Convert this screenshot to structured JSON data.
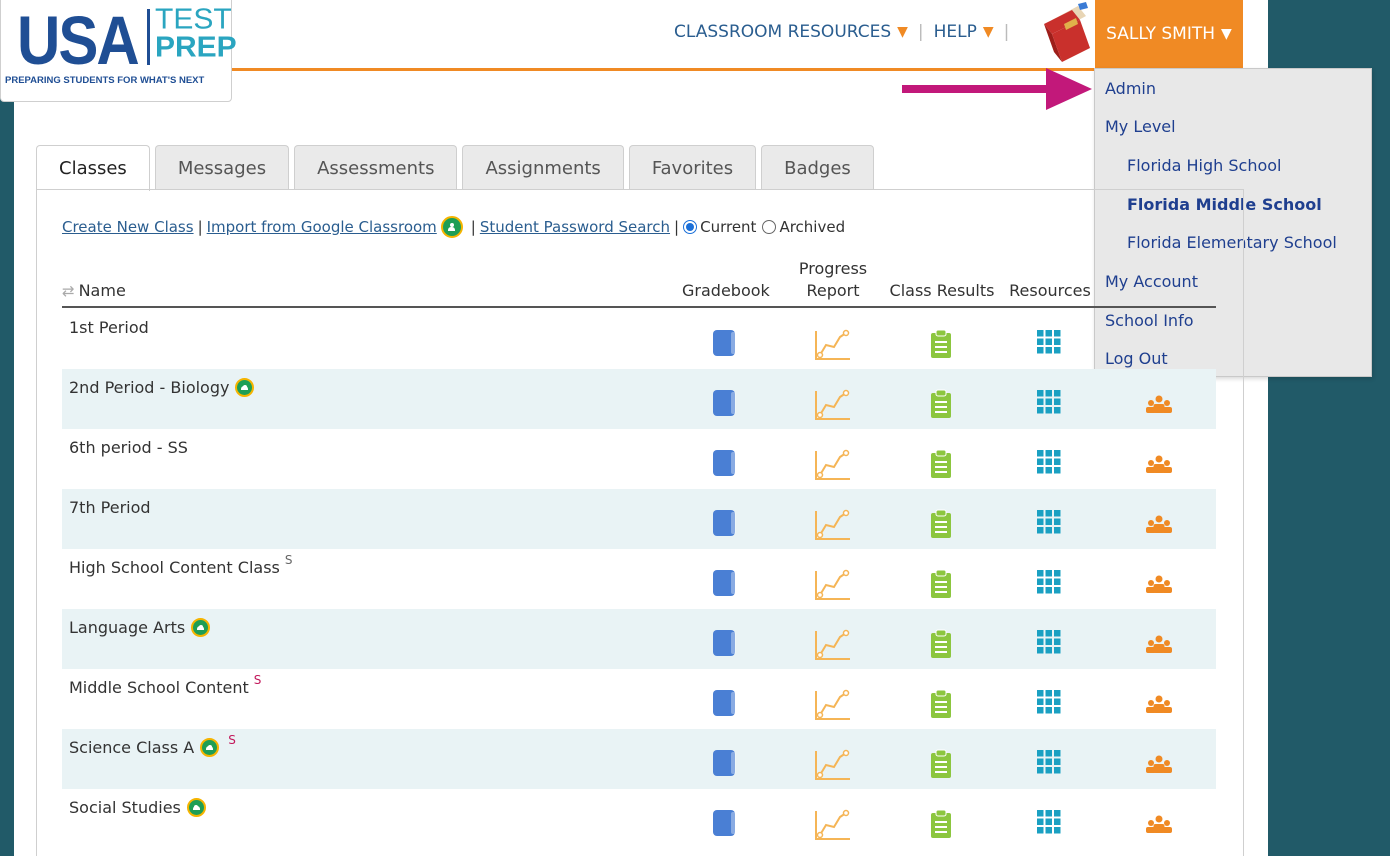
{
  "logo": {
    "usa": "USA",
    "test": "TEST",
    "prep": "PREP",
    "tagline": "PREPARING STUDENTS FOR WHAT'S NEXT"
  },
  "nav": {
    "classroom_resources": "CLASSROOM RESOURCES",
    "help": "HELP",
    "user_name": "SALLY SMITH"
  },
  "dropdown": {
    "admin": "Admin",
    "my_level": "My Level",
    "levels": [
      "Florida High School",
      "Florida Middle School",
      "Florida Elementary School"
    ],
    "active_level": "Florida Middle School",
    "my_account": "My Account",
    "school_info": "School Info",
    "log_out": "Log Out"
  },
  "tabs": [
    "Classes",
    "Messages",
    "Assessments",
    "Assignments",
    "Favorites",
    "Badges"
  ],
  "active_tab": "Classes",
  "filters": {
    "create": "Create New Class",
    "import": "Import from Google Classroom",
    "password_search": "Student Password Search",
    "current": "Current",
    "archived": "Archived",
    "selected": "Current"
  },
  "table": {
    "headers": {
      "name": "Name",
      "gradebook": "Gradebook",
      "progress_line1": "Progress",
      "progress_line2": "Report",
      "class_results": "Class Results",
      "resources": "Resources"
    },
    "rows": [
      {
        "name": "1st Period",
        "google": false,
        "s": ""
      },
      {
        "name": "2nd Period - Biology",
        "google": true,
        "s": ""
      },
      {
        "name": "6th period - SS",
        "google": false,
        "s": ""
      },
      {
        "name": "7th Period",
        "google": false,
        "s": ""
      },
      {
        "name": "High School Content Class",
        "google": false,
        "s": "S",
        "s_color": "gray"
      },
      {
        "name": "Language Arts",
        "google": true,
        "s": ""
      },
      {
        "name": "Middle School Content",
        "google": false,
        "s": "S",
        "s_color": "pink"
      },
      {
        "name": "Science Class A",
        "google": true,
        "s": "S",
        "s_color": "pink"
      },
      {
        "name": "Social Studies",
        "google": true,
        "s": ""
      }
    ]
  },
  "colors": {
    "brand_blue": "#1f4e94",
    "accent_orange": "#f08a24",
    "gradebook_blue": "#4a7fd4",
    "progress_orange": "#f5b556",
    "results_green": "#8cc63f",
    "resources_teal": "#1aa0c2",
    "students_orange": "#f08a24",
    "arrow_magenta": "#c2187a",
    "background": "#215a68"
  }
}
